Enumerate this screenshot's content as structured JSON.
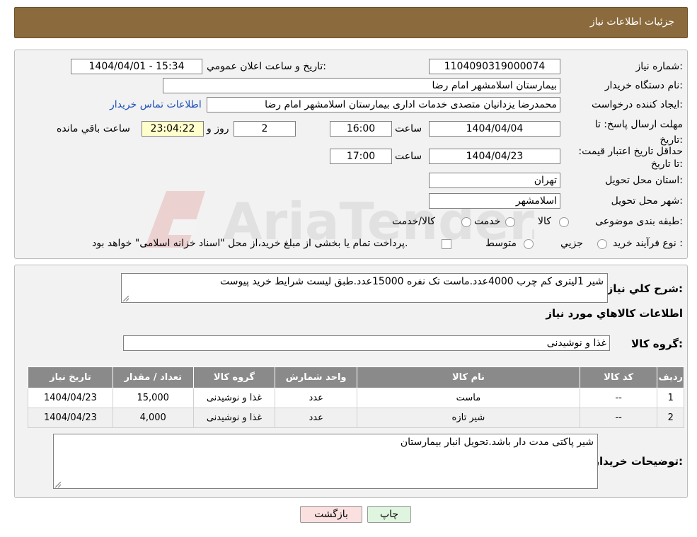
{
  "header": {
    "title": "جزئیات اطلاعات نیاز"
  },
  "form": {
    "need_number_label": "شماره نیاز:",
    "need_number_value": "1104090319000074",
    "announce_label": "تاریخ و ساعت اعلان عمومي:",
    "announce_value": "1404/04/01 - 15:34",
    "buyer_org_label": "نام دستگاه خريدار:",
    "buyer_org_value": "بیمارستان اسلامشهر    امام رضا",
    "requester_label": "ايجاد کننده درخواست:",
    "requester_value": "محمدرضا یزدانیان متصدی خدمات اداری بیمارستان اسلامشهر    امام رضا",
    "contact_link": "اطلاعات تماس خريدار",
    "deadline_label": "مهلت ارسال پاسخ: تا تاریخ:",
    "deadline_date": "1404/04/04",
    "time_label": "ساعت",
    "deadline_time": "16:00",
    "days_value": "2",
    "days_label": "روز و",
    "remaining_value": "23:04:22",
    "remaining_label": "ساعت باقي مانده",
    "validity_label": "حداقل تاریخ اعتبار قیمت: تا تاریخ:",
    "validity_date": "1404/04/23",
    "validity_time": "17:00",
    "province_label": "استان محل تحويل:",
    "province_value": "تهران",
    "city_label": "شهر محل تحويل:",
    "city_value": "اسلامشهر",
    "category_label": "طبقه بندی موضوعی:",
    "category_options": [
      "کالا",
      "خدمت",
      "کالا/خدمت"
    ],
    "process_label": "نوع فرآيند خريد :",
    "process_options": [
      "جزيي",
      "متوسط"
    ],
    "process_note": "پرداخت تمام يا بخشی از مبلغ خريد،از محل \"اسناد خزانه اسلامی\" خواهد بود."
  },
  "details": {
    "summary_label": "شرح کلي نياز:",
    "summary_value": "شیر 1لیتری کم چرب 4000عدد.ماست تک نفره 15000عدد.طبق لیست شرایط خرید پیوست",
    "items_heading": "اطلاعات کالاهاي مورد نياز",
    "group_label": "گروه کالا:",
    "group_value": "غذا و نوشیدنی"
  },
  "table": {
    "headers": [
      "رديف",
      "کد کالا",
      "نام کالا",
      "واحد شمارش",
      "گروه کالا",
      "تعداد / مقدار",
      "تاریخ نیاز"
    ],
    "rows": [
      [
        "1",
        "--",
        "ماست",
        "عدد",
        "غذا و نوشیدنی",
        "15,000",
        "1404/04/23"
      ],
      [
        "2",
        "--",
        "شیر تازه",
        "عدد",
        "غذا و نوشیدنی",
        "4,000",
        "1404/04/23"
      ]
    ]
  },
  "buyer_notes": {
    "label": "توضیحات خريدار:",
    "value": "شیر پاکتی مدت دار باشد.تحویل انبار بیمارستان"
  },
  "buttons": {
    "print": "چاپ",
    "back": "بازگشت"
  },
  "watermark": {
    "text": "AriaTender.neT"
  },
  "colors": {
    "header_bg": "#8b6b3d",
    "table_header_bg": "#8a8a8a",
    "print_bg": "#dff5df",
    "back_bg": "#fbe0e0",
    "link": "#1b4fb8"
  }
}
